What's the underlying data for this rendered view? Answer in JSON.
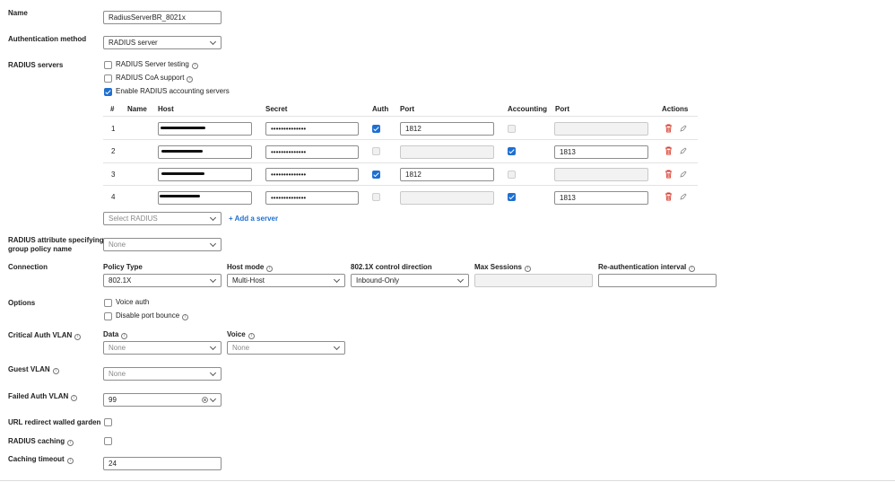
{
  "name": {
    "label": "Name",
    "value": "RadiusServerBR_8021x"
  },
  "auth_method": {
    "label": "Authentication method",
    "value": "RADIUS server"
  },
  "radius_servers": {
    "label": "RADIUS servers",
    "options": [
      {
        "label": "RADIUS Server testing",
        "checked": false,
        "info": true
      },
      {
        "label": "RADIUS CoA support",
        "checked": false,
        "info": true
      },
      {
        "label": "Enable RADIUS accounting servers",
        "checked": true,
        "info": false
      }
    ],
    "columns": [
      "#",
      "Name",
      "Host",
      "Secret",
      "Auth",
      "Port",
      "Accounting",
      "Port",
      "Actions"
    ],
    "rows": [
      {
        "num": "1",
        "host": "",
        "secret": "••••••••••••••",
        "auth": true,
        "auth_port": "1812",
        "accounting": false,
        "acct_port": ""
      },
      {
        "num": "2",
        "host": "",
        "secret": "••••••••••••••",
        "auth": false,
        "auth_port": "",
        "accounting": true,
        "acct_port": "1813"
      },
      {
        "num": "3",
        "host": "",
        "secret": "••••••••••••••",
        "auth": true,
        "auth_port": "1812",
        "accounting": false,
        "acct_port": ""
      },
      {
        "num": "4",
        "host": "",
        "secret": "••••••••••••••",
        "auth": false,
        "auth_port": "",
        "accounting": true,
        "acct_port": "1813"
      }
    ],
    "select_placeholder": "Select RADIUS",
    "add_server_label": "Add a server"
  },
  "group_policy": {
    "label_line1": "RADIUS attribute specifying",
    "label_line2": "group policy name",
    "value": "None"
  },
  "connection": {
    "label": "Connection",
    "policy_type": {
      "label": "Policy Type",
      "value": "802.1X"
    },
    "host_mode": {
      "label": "Host mode",
      "value": "Multi-Host"
    },
    "control_direction": {
      "label": "802.1X control direction",
      "value": "Inbound-Only"
    },
    "max_sessions": {
      "label": "Max Sessions",
      "value": ""
    },
    "reauth_interval": {
      "label": "Re-authentication interval",
      "value": ""
    }
  },
  "options": {
    "label": "Options",
    "voice_auth": {
      "label": "Voice auth",
      "checked": false
    },
    "disable_port_bounce": {
      "label": "Disable port bounce",
      "checked": false
    }
  },
  "critical_auth_vlan": {
    "label": "Critical Auth VLAN",
    "data": {
      "label": "Data",
      "value": "None"
    },
    "voice": {
      "label": "Voice",
      "value": "None"
    }
  },
  "guest_vlan": {
    "label": "Guest VLAN",
    "value": "None"
  },
  "failed_auth_vlan": {
    "label": "Failed Auth VLAN",
    "value": "99"
  },
  "url_redirect": {
    "label": "URL redirect walled garden",
    "checked": false
  },
  "radius_caching": {
    "label": "RADIUS caching",
    "checked": false
  },
  "caching_timeout": {
    "label": "Caching timeout",
    "value": "24"
  },
  "colors": {
    "accent": "#1f6fd1",
    "danger": "#d93a2b"
  }
}
